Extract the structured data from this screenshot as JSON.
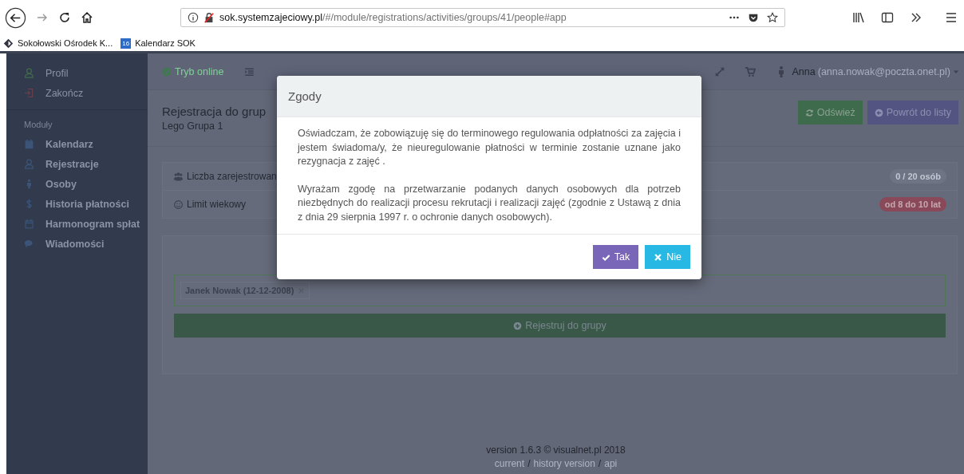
{
  "browser": {
    "url": {
      "host": "sok.systemzajeciowy.pl",
      "path": "/#/module/registrations/activities/groups/41/people#app"
    },
    "bookmarks": [
      {
        "label": "Sokołowski Ośrodek K...",
        "kind": "site"
      },
      {
        "label": "Kalendarz SOK",
        "kind": "calendar",
        "icon_text": "16"
      }
    ]
  },
  "sidebar": {
    "account_items": [
      {
        "label": "Profil",
        "kind": "user",
        "color": "#3f6b4c"
      },
      {
        "label": "Zakończ",
        "kind": "logout",
        "color": "#6b3f4a"
      }
    ],
    "section_label": "Moduły",
    "items": [
      {
        "label": "Kalendarz",
        "kind": "calendar"
      },
      {
        "label": "Rejestracje",
        "kind": "user"
      },
      {
        "label": "Osoby",
        "kind": "person"
      },
      {
        "label": "Historia płatności",
        "kind": "dollar"
      },
      {
        "label": "Harmonogram spłat",
        "kind": "schedule"
      },
      {
        "label": "Wiadomości",
        "kind": "chat"
      }
    ]
  },
  "topbar": {
    "status": "Tryb online",
    "user_name": "Anna",
    "user_email": "(anna.nowak@poczta.onet.pl)"
  },
  "header": {
    "title": "Rejestracja do grup",
    "subtitle": "Lego Grupa 1",
    "buttons": [
      {
        "label": "Odśwież",
        "kind": "refresh"
      },
      {
        "label": "Powrót do listy",
        "kind": "back"
      }
    ]
  },
  "info_rows": [
    {
      "label": "Liczba zarejestrowan",
      "kind": "users",
      "badge": "0 / 20 osób",
      "color": "#6e7484"
    },
    {
      "label": "Limit wiekowy",
      "kind": "smile",
      "badge": "od 8 do 10 lat",
      "color": "#8a4958"
    }
  ],
  "form": {
    "tags": [
      {
        "label": "Janek Nowak (12-12-2008)"
      }
    ],
    "submit": "Rejestruj do grupy"
  },
  "footer": {
    "version": "version 1.6.3 © visualnet.pl 2018",
    "links": [
      {
        "label": "current"
      },
      {
        "label": "history version"
      },
      {
        "label": "api"
      }
    ],
    "separator": "/"
  },
  "modal": {
    "title": "Zgody",
    "paragraphs": [
      "Oświadczam, że zobowiązuję się do terminowego regulowania odpłatności za zajęcia i jestem świadoma/y, że nieuregulowanie płatności w terminie zostanie uznane jako rezygnacja z zajęć .",
      "Wyrażam zgodę na przetwarzanie podanych danych osobowych dla potrzeb niezbędnych do realizacji procesu rekrutacji i realizacji zajęć (zgodnie z Ustawą z dnia z dnia 29 sierpnia 1997 r. o ochronie danych osobowych)."
    ],
    "buttons": [
      {
        "label": "Tak",
        "kind": "confirm"
      },
      {
        "label": "Nie",
        "kind": "cancel"
      }
    ]
  }
}
